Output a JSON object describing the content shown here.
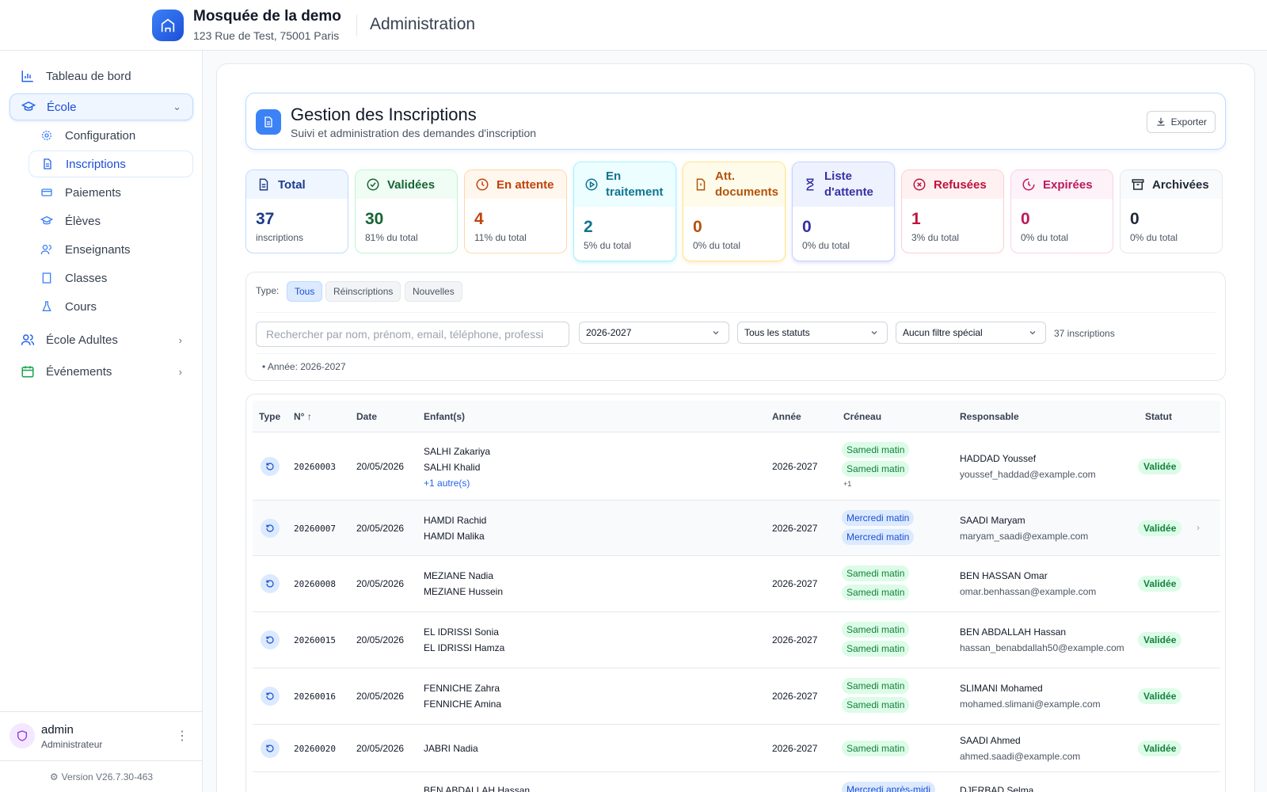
{
  "header": {
    "org_name": "Mosquée de la demo",
    "org_address": "123 Rue de Test, 75001 Paris",
    "section": "Administration"
  },
  "sidebar": {
    "items": [
      {
        "label": "Tableau de bord",
        "icon": "bar-chart-icon"
      },
      {
        "label": "École",
        "icon": "graduation-cap-icon",
        "expanded": true
      },
      {
        "label": "École Adultes",
        "icon": "users-icon"
      },
      {
        "label": "Événements",
        "icon": "calendar-icon"
      }
    ],
    "school_sub": [
      {
        "label": "Configuration",
        "icon": "gear-icon"
      },
      {
        "label": "Inscriptions",
        "icon": "document-icon",
        "active": true
      },
      {
        "label": "Paiements",
        "icon": "credit-card-icon"
      },
      {
        "label": "Élèves",
        "icon": "graduation-cap-icon"
      },
      {
        "label": "Enseignants",
        "icon": "users-icon"
      },
      {
        "label": "Classes",
        "icon": "building-icon"
      },
      {
        "label": "Cours",
        "icon": "flask-icon"
      }
    ],
    "user": {
      "name": "admin",
      "role": "Administrateur"
    },
    "version": "Version V26.7.30-463"
  },
  "page": {
    "title": "Gestion des Inscriptions",
    "subtitle": "Suivi et administration des demandes d'inscription",
    "export_label": "Exporter"
  },
  "stats": [
    {
      "label": "Total",
      "value": "37",
      "sub": "inscriptions",
      "color": "#1e3a8a"
    },
    {
      "label": "Validées",
      "value": "30",
      "sub": "81% du total",
      "color": "#166534"
    },
    {
      "label": "En attente",
      "value": "4",
      "sub": "11% du total",
      "color": "#c2410c"
    },
    {
      "label": "En traitement",
      "value": "2",
      "sub": "5% du total",
      "color": "#0e7490"
    },
    {
      "label": "Att. documents",
      "value": "0",
      "sub": "0% du total",
      "color": "#b45309"
    },
    {
      "label": "Liste d'attente",
      "value": "0",
      "sub": "0% du total",
      "color": "#3730a3"
    },
    {
      "label": "Refusées",
      "value": "1",
      "sub": "3% du total",
      "color": "#be123c"
    },
    {
      "label": "Expirées",
      "value": "0",
      "sub": "0% du total",
      "color": "#be185d"
    },
    {
      "label": "Archivées",
      "value": "0",
      "sub": "0% du total",
      "color": "#1f2937"
    }
  ],
  "filters": {
    "type_label": "Type:",
    "type_chips": [
      "Tous",
      "Réinscriptions",
      "Nouvelles"
    ],
    "search_placeholder": "Rechercher par nom, prénom, email, téléphone, professi",
    "year": "2026-2027",
    "status": "Tous les statuts",
    "special": "Aucun filtre spécial",
    "count": "37 inscriptions",
    "active_note": "• Année: 2026-2027"
  },
  "table": {
    "headers": [
      "Type",
      "N°",
      "Date",
      "Enfant(s)",
      "Année",
      "Créneau",
      "Responsable",
      "Statut"
    ],
    "sort_arrow": "↑",
    "rows": [
      {
        "num": "20260003",
        "date": "20/05/2026",
        "children": [
          "SALHI Zakariya",
          "SALHI Khalid"
        ],
        "more": "+1 autre(s)",
        "year": "2026-2027",
        "slots": [
          "Samedi matin",
          "Samedi matin"
        ],
        "slots_more": "+1",
        "resp": "HADDAD Youssef",
        "email": "youssef_haddad@example.com",
        "status": "Validée"
      },
      {
        "num": "20260007",
        "date": "20/05/2026",
        "children": [
          "HAMDI Rachid",
          "HAMDI Malika"
        ],
        "year": "2026-2027",
        "slots": [
          "Mercredi matin",
          "Mercredi matin"
        ],
        "resp": "SAADI Maryam",
        "email": "maryam_saadi@example.com",
        "status": "Validée"
      },
      {
        "num": "20260008",
        "date": "20/05/2026",
        "children": [
          "MEZIANE Nadia",
          "MEZIANE Hussein"
        ],
        "year": "2026-2027",
        "slots": [
          "Samedi matin",
          "Samedi matin"
        ],
        "resp": "BEN HASSAN Omar",
        "email": "omar.benhassan@example.com",
        "status": "Validée"
      },
      {
        "num": "20260015",
        "date": "20/05/2026",
        "children": [
          "EL IDRISSI Sonia",
          "EL IDRISSI Hamza"
        ],
        "year": "2026-2027",
        "slots": [
          "Samedi matin",
          "Samedi matin"
        ],
        "resp": "BEN ABDALLAH Hassan",
        "email": "hassan_benabdallah50@example.com",
        "status": "Validée"
      },
      {
        "num": "20260016",
        "date": "20/05/2026",
        "children": [
          "FENNICHE Zahra",
          "FENNICHE Amina"
        ],
        "year": "2026-2027",
        "slots": [
          "Samedi matin",
          "Samedi matin"
        ],
        "resp": "SLIMANI Mohamed",
        "email": "mohamed.slimani@example.com",
        "status": "Validée"
      },
      {
        "num": "20260020",
        "date": "20/05/2026",
        "children": [
          "JABRI Nadia"
        ],
        "year": "2026-2027",
        "slots": [
          "Samedi matin"
        ],
        "resp": "SAADI Ahmed",
        "email": "ahmed.saadi@example.com",
        "status": "Validée"
      },
      {
        "children": [
          "BEN ABDALLAH Hassan"
        ],
        "slots": [
          "Mercredi après-midi"
        ],
        "resp": "DJERBAD Selma"
      }
    ]
  }
}
